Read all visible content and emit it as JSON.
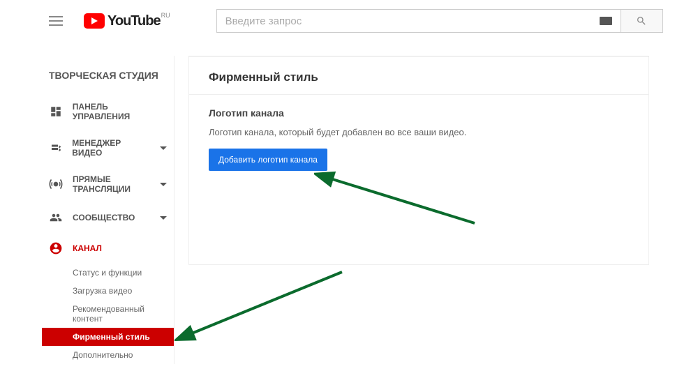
{
  "header": {
    "logo_text": "YouTube",
    "logo_region": "RU",
    "search_placeholder": "Введите запрос"
  },
  "sidebar": {
    "title": "ТВОРЧЕСКАЯ СТУДИЯ",
    "items": [
      {
        "label": "ПАНЕЛЬ УПРАВЛЕНИЯ"
      },
      {
        "label": "МЕНЕДЖЕР ВИДЕО"
      },
      {
        "label": "ПРЯМЫЕ ТРАНСЛЯЦИИ"
      },
      {
        "label": "СООБЩЕСТВО"
      }
    ],
    "channel": {
      "label": "КАНАЛ",
      "subitems": [
        {
          "label": "Статус и функции"
        },
        {
          "label": "Загрузка видео"
        },
        {
          "label": "Рекомендованный контент"
        },
        {
          "label": "Фирменный стиль"
        },
        {
          "label": "Дополнительно"
        }
      ]
    }
  },
  "main": {
    "title": "Фирменный стиль",
    "section_heading": "Логотип канала",
    "section_desc": "Логотип канала, который будет добавлен во все ваши видео.",
    "button_label": "Добавить логотип канала"
  }
}
